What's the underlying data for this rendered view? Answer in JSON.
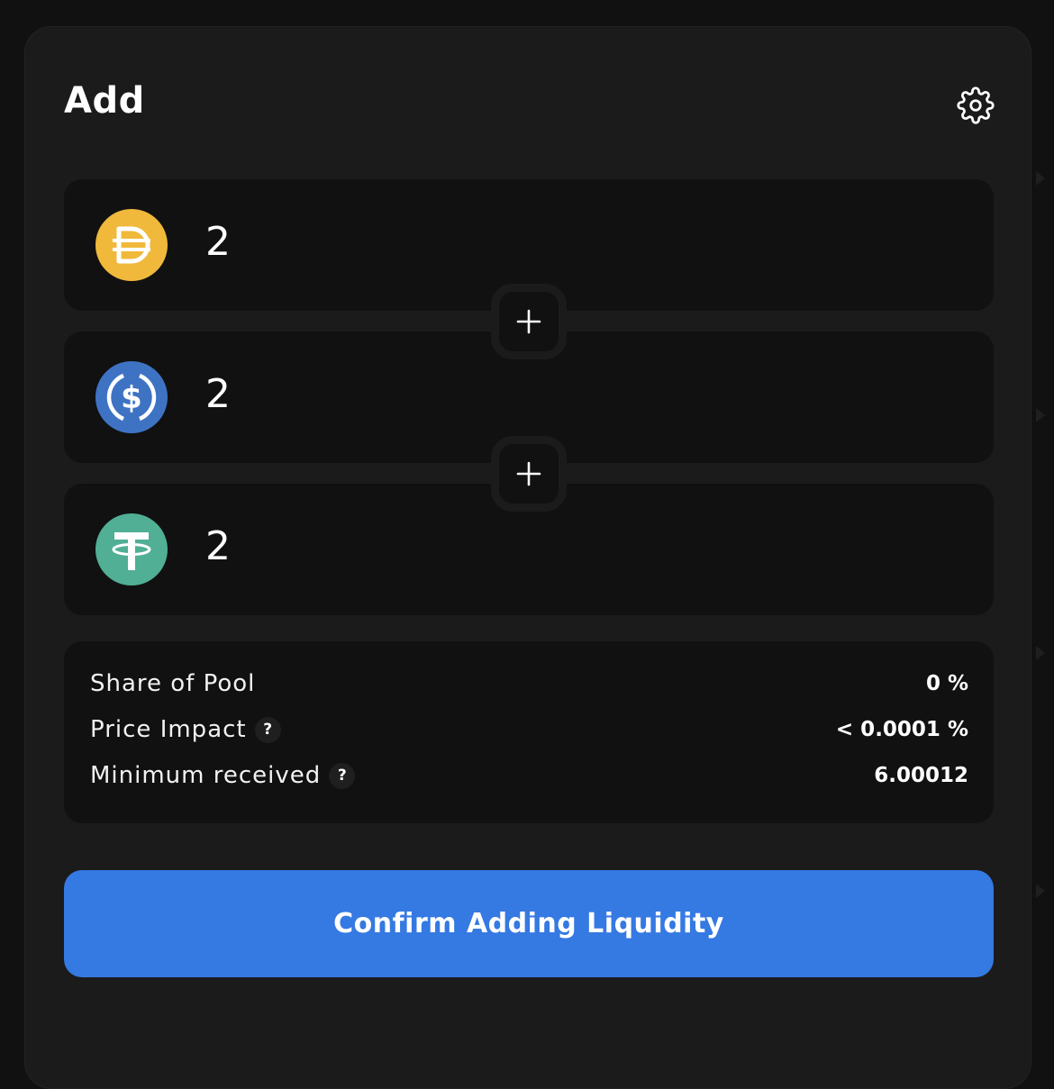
{
  "page": {
    "title": "Add",
    "settings_icon": "gear-icon"
  },
  "tokens": [
    {
      "name": "DAI",
      "icon": "dai-token-icon",
      "color": "#f0b93b",
      "amount": "2"
    },
    {
      "name": "USDC",
      "icon": "usdc-token-icon",
      "color": "#3e73c4",
      "amount": "2"
    },
    {
      "name": "USDT",
      "icon": "usdt-token-icon",
      "color": "#50af95",
      "amount": "2"
    }
  ],
  "plus_icon": "plus-icon",
  "details": {
    "share_of_pool": {
      "label": "Share of Pool",
      "value": "0 %"
    },
    "price_impact": {
      "label": "Price Impact",
      "help": "?",
      "value": "< 0.0001 %"
    },
    "minimum_received": {
      "label": "Minimum received",
      "help": "?",
      "value": "6.00012"
    }
  },
  "confirm_button": {
    "label": "Confirm Adding Liquidity",
    "color": "#3579e2"
  }
}
